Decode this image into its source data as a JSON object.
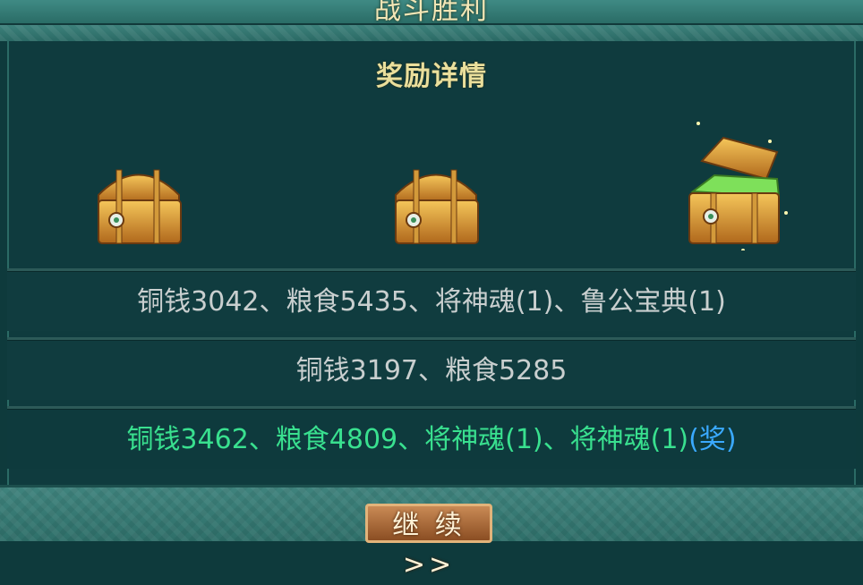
{
  "header": {
    "title": "战斗胜利"
  },
  "panel": {
    "title": "奖励详情"
  },
  "rewards": {
    "row1": "铜钱3042、粮食5435、将神魂(1)、鲁公宝典(1)",
    "row2": "铜钱3197、粮食5285",
    "row3_main": "铜钱3462、粮食4809、将神魂(1)、将神魂(1)",
    "row3_bonus": "(奖)"
  },
  "chests": [
    {
      "state": "closed",
      "icon": "treasure-chest-icon"
    },
    {
      "state": "closed",
      "icon": "treasure-chest-icon"
    },
    {
      "state": "open",
      "icon": "open-treasure-chest-icon"
    }
  ],
  "buttons": {
    "continue": "继 续>>"
  },
  "colors": {
    "panel_bg": "#0f3b3e",
    "title_gold": "#eadf9c",
    "reward_gray": "#c9cfcf",
    "reward_green": "#39e08f",
    "bonus_blue": "#3aa9ff"
  }
}
